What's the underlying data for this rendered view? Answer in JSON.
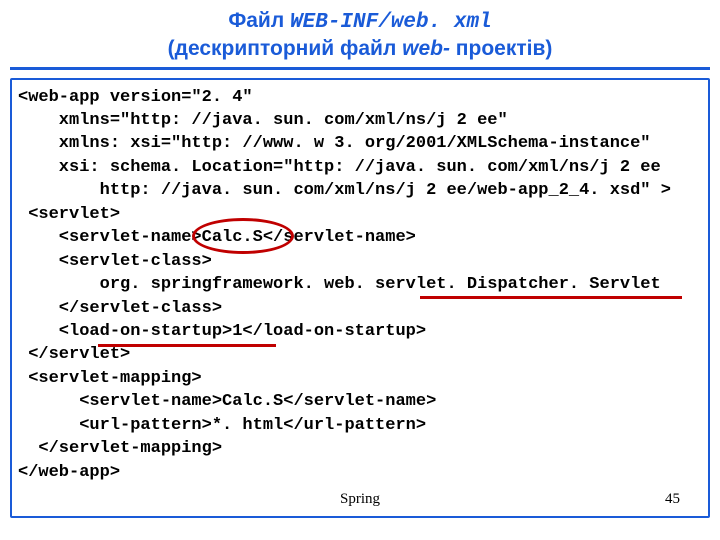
{
  "title": {
    "prefix": "Файл ",
    "mono": "WEB-INF/web. xml",
    "line2_a": "(дескрипторний файл ",
    "line2_b": "web-",
    "line2_c": " проектів)"
  },
  "code": {
    "l1": "<web-app version=\"2. 4\"",
    "l2": "    xmlns=\"http: //java. sun. com/xml/ns/j 2 ee\"",
    "l3": "    xmlns: xsi=\"http: //www. w 3. org/2001/XMLSchema-instance\"",
    "l4": "    xsi: schema. Location=\"http: //java. sun. com/xml/ns/j 2 ee",
    "l5": "        http: //java. sun. com/xml/ns/j 2 ee/web-app_2_4. xsd\" >",
    "l6": " <servlet>",
    "l7": "    <servlet-name>Calc.S</servlet-name>",
    "l8": "    <servlet-class>",
    "l9": "        org. springframework. web. servlet. Dispatcher. Servlet",
    "l10": "    </servlet-class>",
    "l11": "    <load-on-startup>1</load-on-startup>",
    "l12": " </servlet>",
    "l13": " <servlet-mapping>",
    "l14": "      <servlet-name>Calc.S</servlet-name>",
    "l15": "      <url-pattern>*. html</url-pattern>",
    "l16": "  </servlet-mapping>",
    "l17": "</web-app>"
  },
  "footer": {
    "name": "Spring",
    "page": "45"
  }
}
